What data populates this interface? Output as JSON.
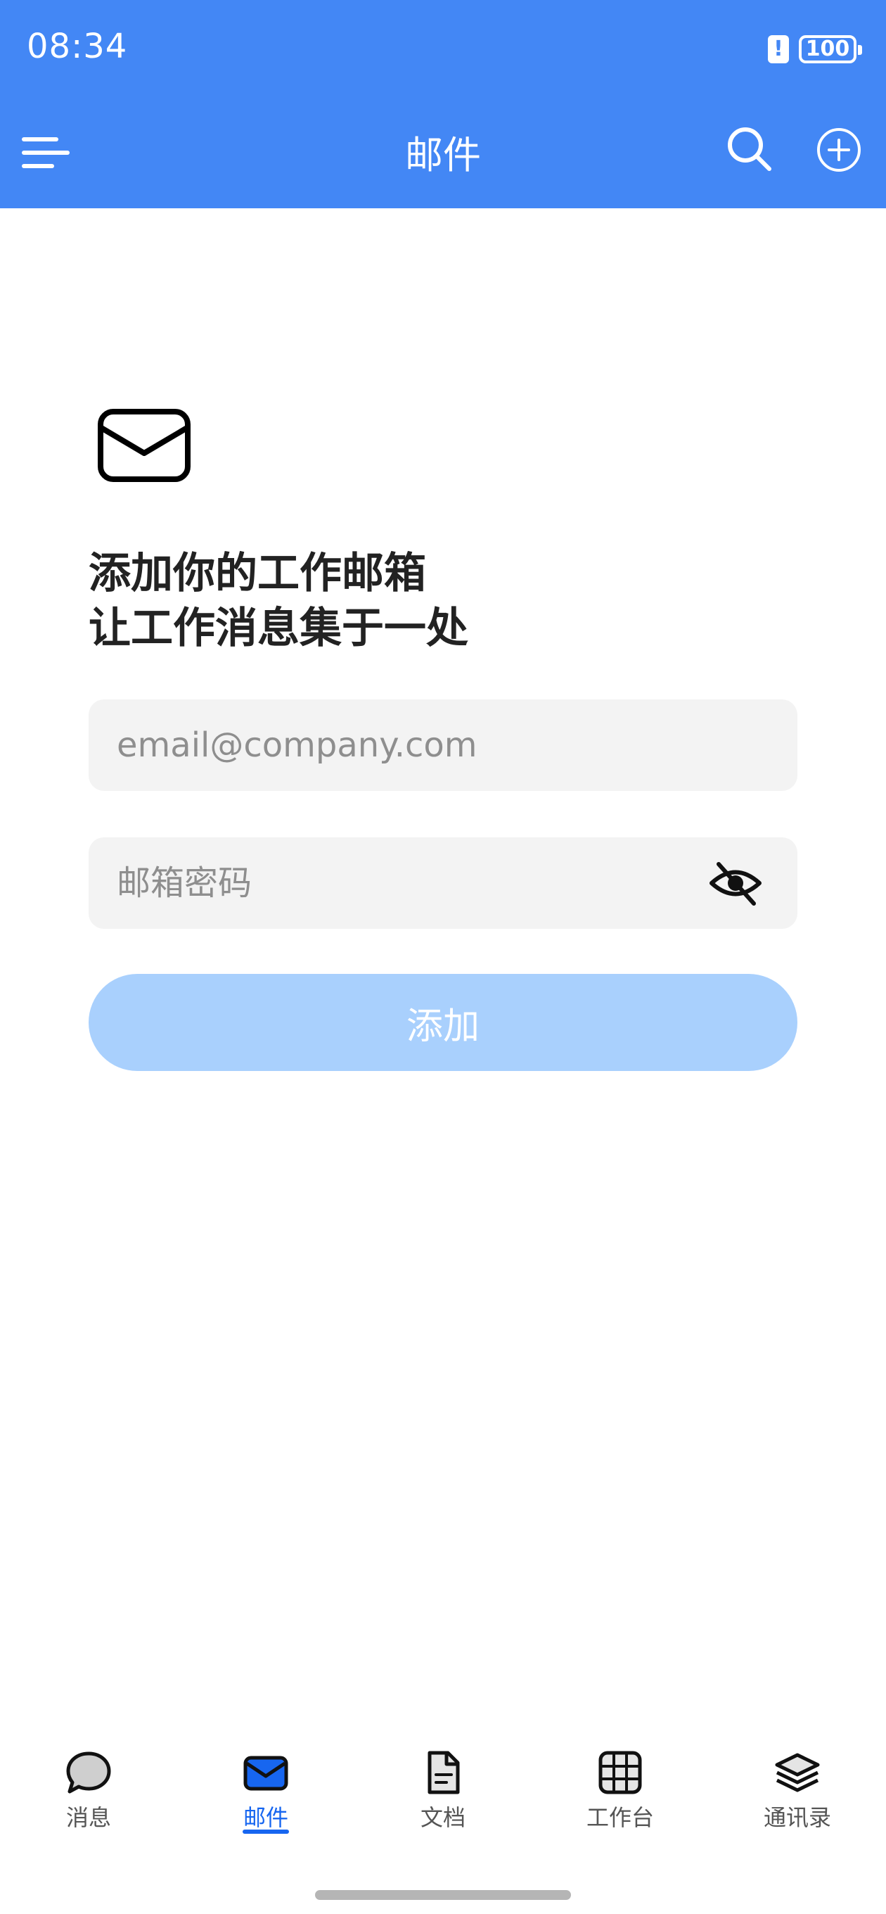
{
  "status_bar": {
    "time": "08:34",
    "alert_badge": "!",
    "battery": "100"
  },
  "app_bar": {
    "title": "邮件"
  },
  "content": {
    "headline_line1": "添加你的工作邮箱",
    "headline_line2": "让工作消息集于一处",
    "email_placeholder": "email@company.com",
    "email_value": "",
    "password_placeholder": "邮箱密码",
    "password_value": "",
    "add_button_label": "添加"
  },
  "bottom_nav": {
    "items": [
      {
        "label": "消息",
        "icon": "chat-bubble-icon",
        "active": false
      },
      {
        "label": "邮件",
        "icon": "mail-icon",
        "active": true
      },
      {
        "label": "文档",
        "icon": "document-icon",
        "active": false
      },
      {
        "label": "工作台",
        "icon": "grid-icon",
        "active": false
      },
      {
        "label": "通讯录",
        "icon": "layers-icon",
        "active": false
      }
    ]
  },
  "colors": {
    "header_blue": "#4387f5",
    "active_tab": "#1766f0",
    "button_disabled": "#a9d0fd",
    "input_bg": "#f3f3f3"
  }
}
